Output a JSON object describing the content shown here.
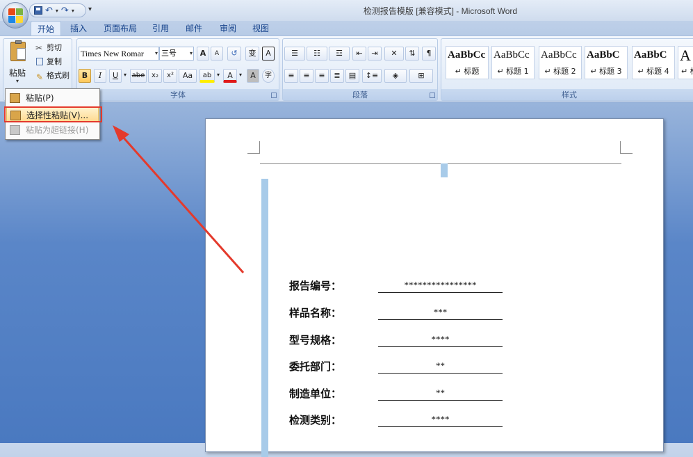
{
  "window": {
    "title": "检测报告模版 [兼容模式] - Microsoft Word"
  },
  "quick_access": {
    "more": "▾"
  },
  "tabs": [
    "开始",
    "插入",
    "页面布局",
    "引用",
    "邮件",
    "审阅",
    "视图"
  ],
  "clipboard": {
    "paste_label": "粘贴",
    "cut_label": "剪切",
    "copy_label": "复制",
    "format_painter_label": "格式刷"
  },
  "font": {
    "name": "Times New Romar",
    "size": "三号",
    "group_label": "字体",
    "grow": "A",
    "shrink": "A",
    "bold": "B",
    "italic": "I",
    "underline": "U",
    "strike": "abe",
    "subscript": "x₂",
    "superscript": "x²",
    "change_case": "Aa",
    "highlight": "ab",
    "font_color": "A",
    "char_shading": "A",
    "phonetic": "变",
    "char_border": "A",
    "enclosed": "字"
  },
  "paragraph": {
    "group_label": "段落"
  },
  "styles": {
    "group_label": "样式",
    "tiles": [
      {
        "preview": "AaBbCc",
        "name": "↵ 标题"
      },
      {
        "preview": "AaBbCc",
        "name": "↵ 标题 1"
      },
      {
        "preview": "AaBbCc",
        "name": "↵ 标题 2"
      },
      {
        "preview": "AaBbC",
        "name": "↵ 标题 3"
      },
      {
        "preview": "AaBbC",
        "name": "↵ 标题 4"
      },
      {
        "preview": "A",
        "name": "↵ 标"
      }
    ]
  },
  "paste_menu": [
    {
      "label": "粘贴(P)",
      "state": "normal"
    },
    {
      "label": "选择性粘贴(V)...",
      "state": "highlighted"
    },
    {
      "label": "粘贴为超链接(H)",
      "state": "disabled"
    }
  ],
  "document": {
    "fields": [
      {
        "label": "报告编号：",
        "value": "****************"
      },
      {
        "label": "样品名称：",
        "value": "***"
      },
      {
        "label": "型号规格：",
        "value": "****"
      },
      {
        "label": "委托部门：",
        "value": "**"
      },
      {
        "label": "制造单位：",
        "value": "**"
      },
      {
        "label": "检测类别：",
        "value": "****"
      }
    ]
  },
  "colors": {
    "annotation": "#e43a2c",
    "highlight": "#ffd98e",
    "ribbon_text": "#15428b"
  }
}
